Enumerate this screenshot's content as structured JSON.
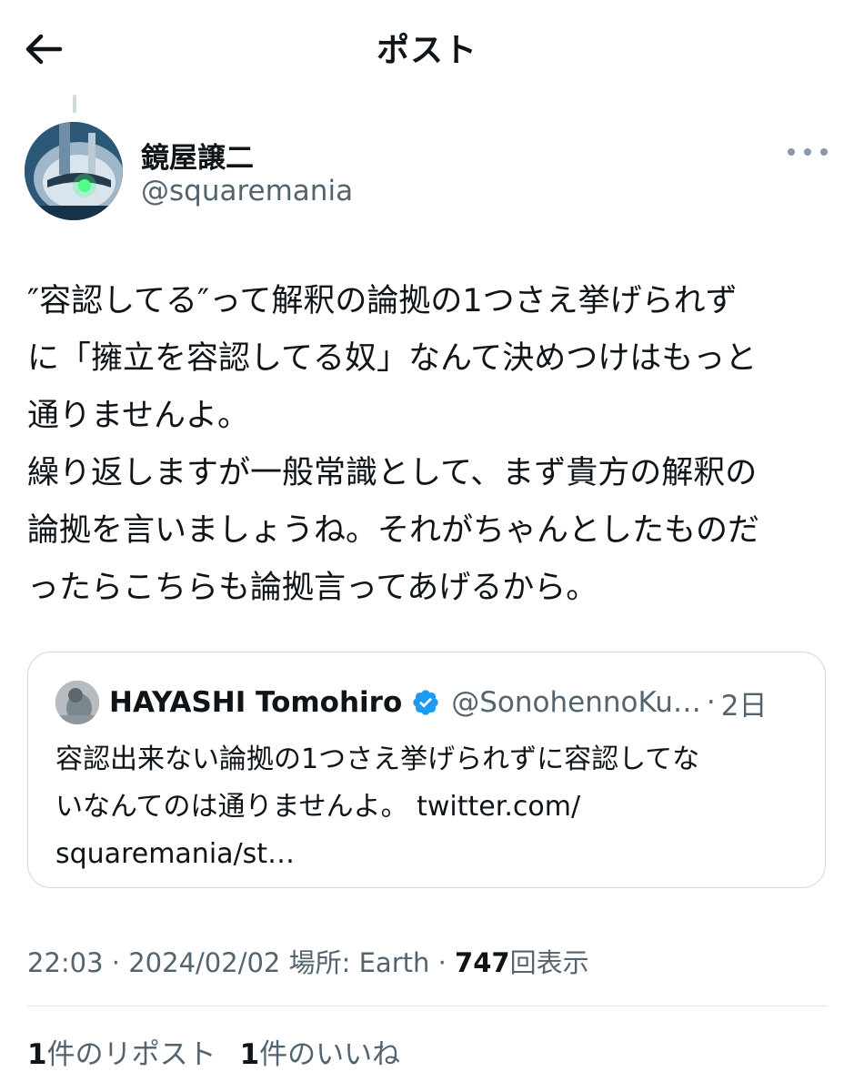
{
  "header": {
    "title": "ポスト"
  },
  "author": {
    "name": "鏡屋譲二",
    "handle": "@squaremania"
  },
  "tweet": {
    "text": "″容認してる″って解釈の論拠の1つさえ挙げられず\nに「擁立を容認してる奴」なんて決めつけはもっと\n通りませんよ。\n繰り返しますが一般常識として、まず貴方の解釈の\n論拠を言いましょうね。それがちゃんとしたものだ\nったらこちらも論拠言ってあげるから。"
  },
  "quote": {
    "name": "HAYASHI Tomohiro",
    "handle": "@SonohennoKu…",
    "separator": "·",
    "time": "2日",
    "text": "容認出来ない論拠の1つさえ挙げられずに容認してな\nいなんてのは通りませんよ。 twitter.com/\nsquaremania/st…"
  },
  "meta": {
    "time": "22:03",
    "sep1": "·",
    "date": "2024/02/02",
    "location_label": "場所:",
    "location": "Earth",
    "sep2": "·",
    "views_count": "747",
    "views_label": "回表示"
  },
  "stats": {
    "reposts_count": "1",
    "reposts_label": "件のリポスト",
    "likes_count": "1",
    "likes_label": "件のいいね"
  },
  "colors": {
    "text": "#0f1419",
    "secondary": "#536471",
    "border": "#cfd9de",
    "verified": "#1d9bf0"
  },
  "icons": {
    "back": "arrow-left-icon",
    "more": "more-horizontal-icon",
    "verified": "verified-badge-icon"
  }
}
